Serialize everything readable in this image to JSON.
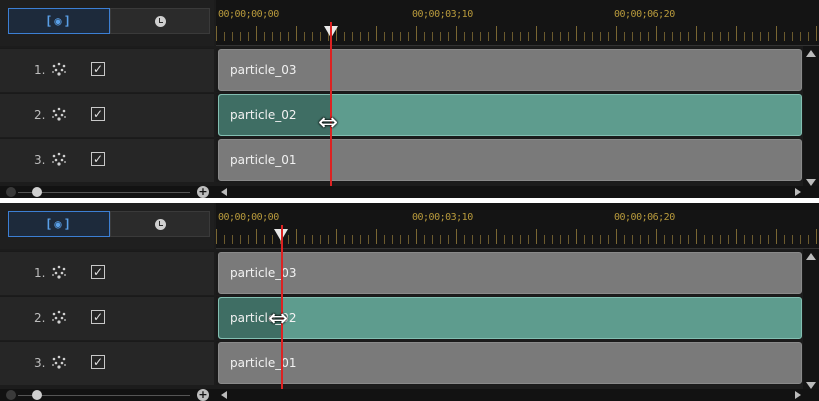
{
  "mode_buttons": {
    "frame_icon": "[◉]",
    "frame_icon_name": "frame-mode-icon",
    "clock_icon_name": "clock-icon"
  },
  "panels": [
    {
      "timecodes": [
        "00;00;00;00",
        "00;00;03;10",
        "00;00;06;20"
      ],
      "tracks": [
        {
          "num": "1.",
          "clip": "particle_03",
          "checked": "✓"
        },
        {
          "num": "2.",
          "clip": "particle_02",
          "checked": "✓"
        },
        {
          "num": "3.",
          "clip": "particle_01",
          "checked": "✓"
        }
      ]
    },
    {
      "timecodes": [
        "00;00;00;00",
        "00;00;03;10",
        "00;00;06;20"
      ],
      "tracks": [
        {
          "num": "1.",
          "clip": "particle_03",
          "checked": "✓"
        },
        {
          "num": "2.",
          "clip": "particle_02",
          "checked": "✓"
        },
        {
          "num": "3.",
          "clip": "particle_01",
          "checked": "✓"
        }
      ]
    }
  ],
  "zoom": {
    "plus": "+"
  },
  "colors": {
    "selected_clip": "#5e9c8e",
    "clip": "#7a7a7a",
    "playhead": "#dd2222",
    "timecode": "#b89a3c",
    "accent": "#3c7fd4"
  }
}
